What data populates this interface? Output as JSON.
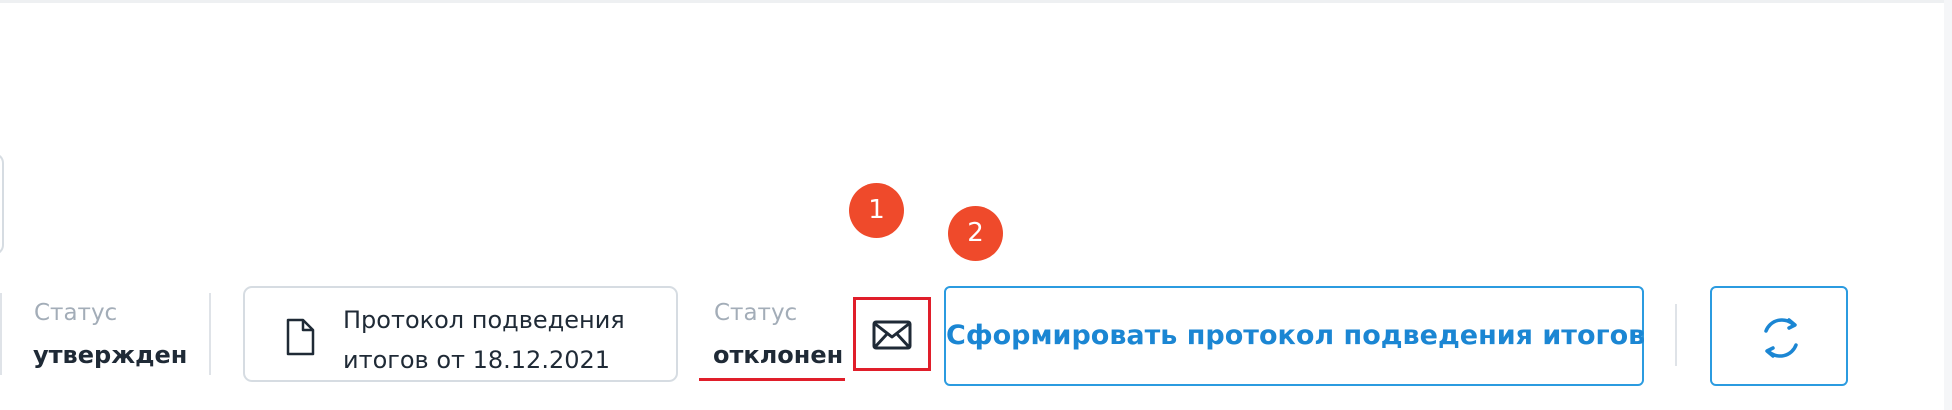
{
  "statuses": [
    {
      "label": "Статус",
      "value": "утвержден"
    },
    {
      "label": "Статус",
      "value": "отклонен"
    }
  ],
  "document": {
    "line1": "Протокол подведения",
    "line2": "итогов от 18.12.2021",
    "icon": "document-icon"
  },
  "mail_button": {
    "icon": "envelope-icon"
  },
  "markers": [
    "1",
    "2"
  ],
  "primary_button": {
    "label": "Сформировать протокол подведения итогов"
  },
  "refresh_button": {
    "icon": "refresh-icon"
  },
  "colors": {
    "accent": "#2b9be0",
    "accent_text": "#1b86d3",
    "highlight_red": "#e01e2a",
    "marker": "#ef4a2b",
    "muted_label": "#a3adb8",
    "text": "#1f2a36",
    "border": "#d6dce2"
  }
}
